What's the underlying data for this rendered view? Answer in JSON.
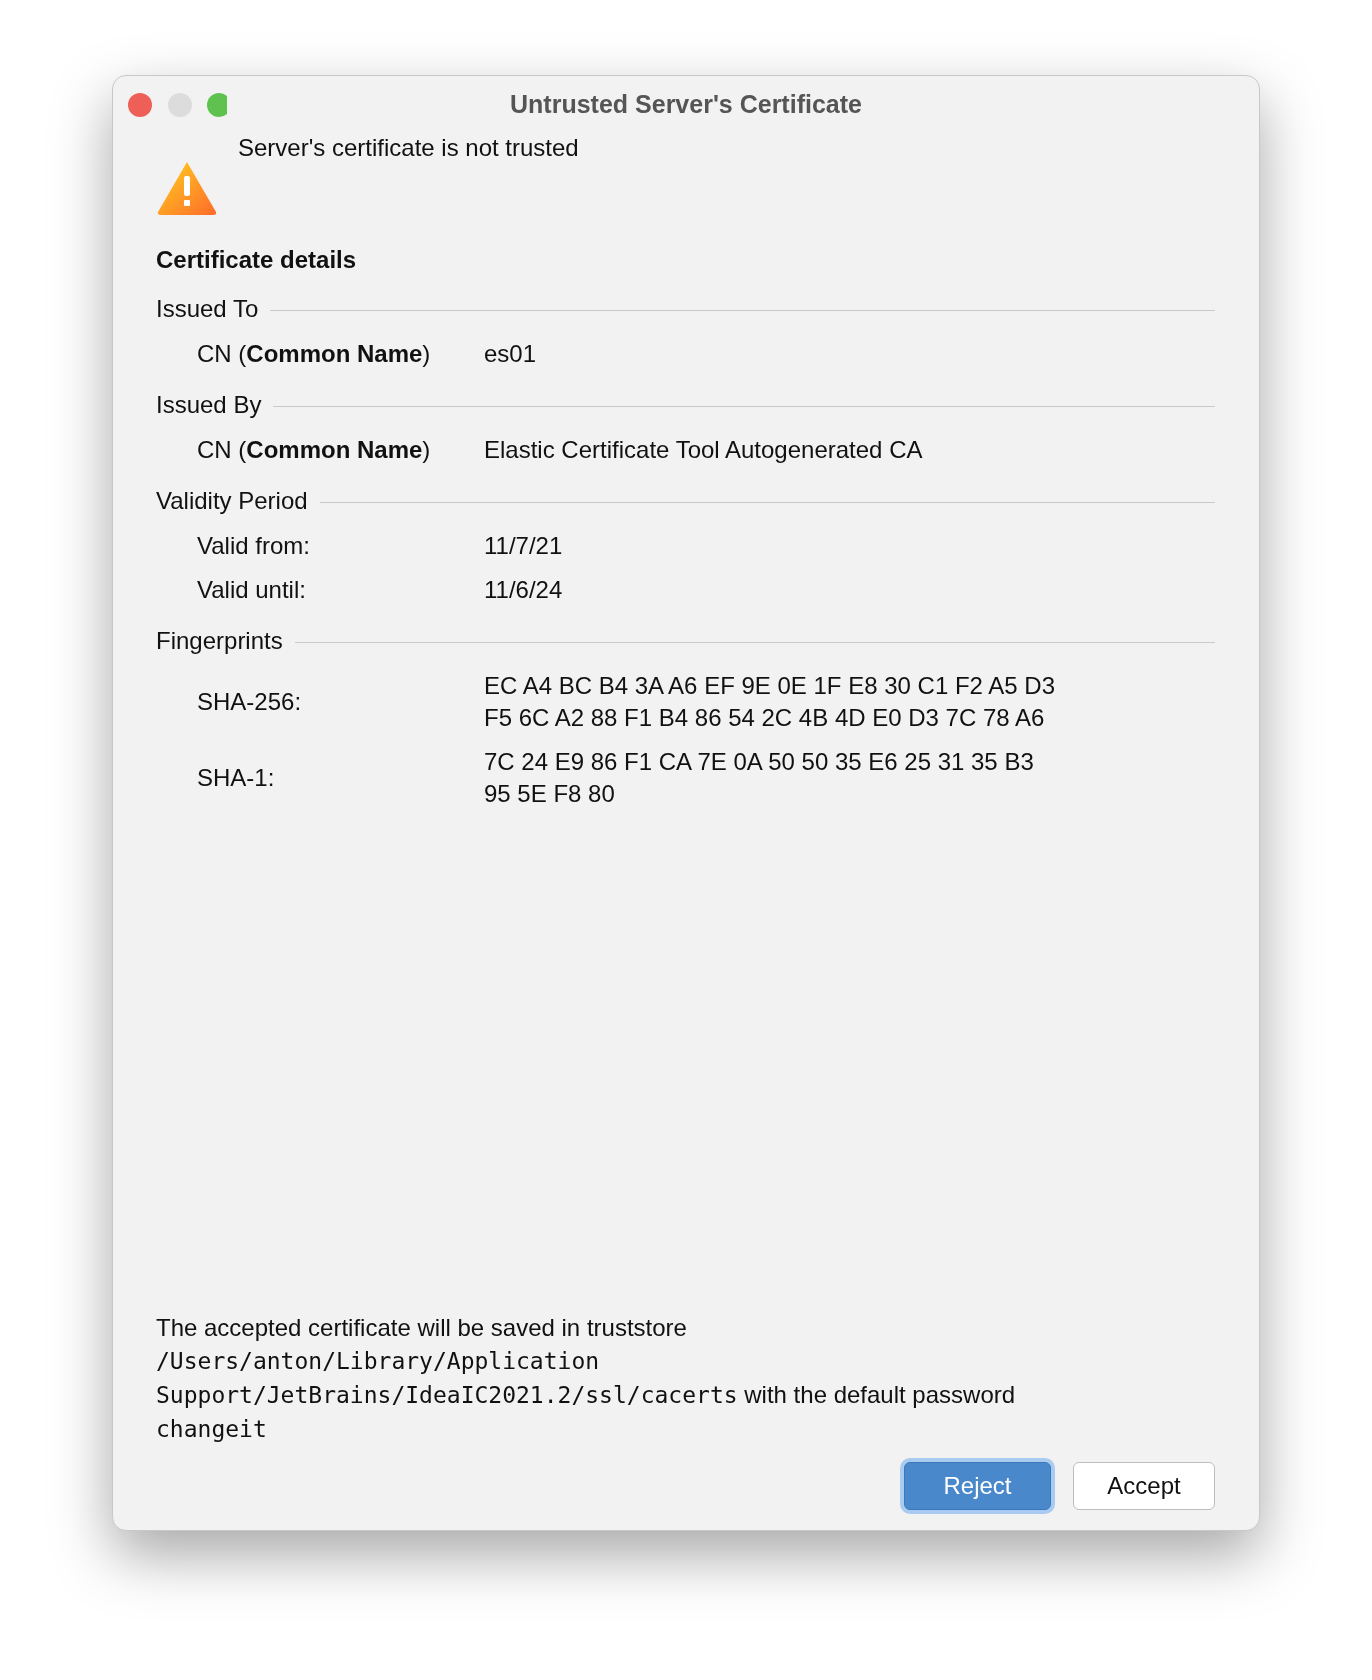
{
  "window": {
    "title": "Untrusted Server's Certificate"
  },
  "message": "Server's certificate is not trusted",
  "details_heading": "Certificate details",
  "sections": [
    {
      "title": "Issued To",
      "rows": [
        {
          "label": "CN (**Common Name**)",
          "value": [
            "es01"
          ]
        }
      ]
    },
    {
      "title": "Issued By",
      "rows": [
        {
          "label": "CN (**Common Name**)",
          "value": [
            "Elastic Certificate Tool Autogenerated CA"
          ]
        }
      ]
    },
    {
      "title": "Validity Period",
      "rows": [
        {
          "label": "Valid from:",
          "value": [
            "11/7/21"
          ]
        },
        {
          "label": "Valid until:",
          "value": [
            "11/6/24"
          ]
        }
      ]
    },
    {
      "title": "Fingerprints",
      "rows": [
        {
          "label": "SHA-256:",
          "value": [
            "EC A4 BC B4 3A A6 EF 9E 0E 1F E8 30 C1 F2 A5 D3",
            "F5 6C A2 88 F1 B4 86 54 2C 4B 4D E0 D3 7C 78 A6"
          ]
        },
        {
          "label": "SHA-1:",
          "value": [
            "7C 24 E9 86 F1 CA 7E 0A 50 50 35 E6 25 31 35 B3",
            "95 5E F8 80"
          ]
        }
      ]
    }
  ],
  "footer": [
    [
      {
        "kind": "plain",
        "text": "The accepted certificate will be saved in truststore"
      }
    ],
    [
      {
        "kind": "mono",
        "text": "/Users/anton/Library/Application"
      }
    ],
    [
      {
        "kind": "mono",
        "text": "Support/JetBrains/IdeaIC2021.2/ssl/cacerts"
      },
      {
        "kind": "plain",
        "text": " with the default password"
      }
    ],
    [
      {
        "kind": "mono",
        "text": "changeit"
      }
    ]
  ],
  "buttons": [
    {
      "label": "Reject",
      "default": true
    },
    {
      "label": "Accept",
      "default": false
    }
  ]
}
